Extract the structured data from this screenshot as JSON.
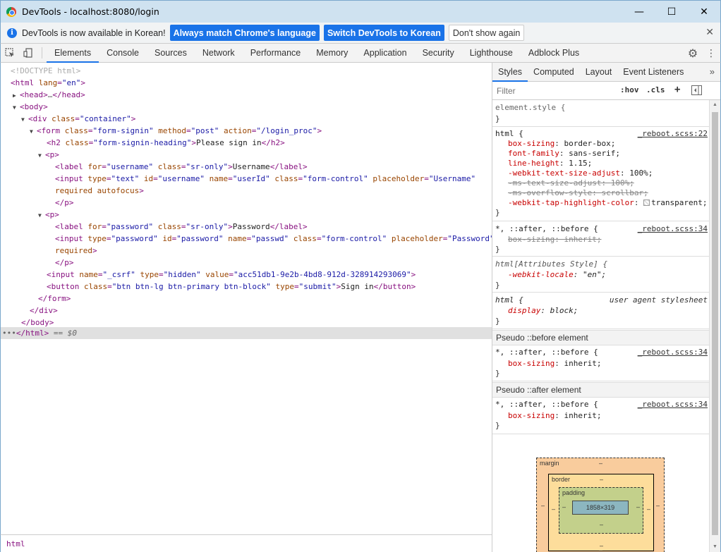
{
  "window": {
    "title": "DevTools - localhost:8080/login",
    "controls": {
      "minimize": "—",
      "maximize": "☐",
      "close": "✕"
    }
  },
  "infobar": {
    "message": "DevTools is now available in Korean!",
    "btn_match": "Always match Chrome's language",
    "btn_switch": "Switch DevTools to Korean",
    "btn_dismiss": "Don't show again",
    "close": "✕"
  },
  "toolbar": {
    "tabs": [
      "Elements",
      "Console",
      "Sources",
      "Network",
      "Performance",
      "Memory",
      "Application",
      "Security",
      "Lighthouse",
      "Adblock Plus"
    ],
    "active_tab": "Elements"
  },
  "dom": {
    "doctype": "<!DOCTYPE html>",
    "html_open": "html",
    "html_lang_attr": "lang",
    "html_lang_val": "\"en\"",
    "head": "head",
    "head_ellipsis": "…",
    "body": "body",
    "div_class_val": "\"container\"",
    "form_class_val": "\"form-signin\"",
    "form_method_val": "\"post\"",
    "form_action_val": "\"/login_proc\"",
    "h2_class_val": "\"form-signin-heading\"",
    "h2_text": "Please sign in",
    "label_user_for_val": "\"username\"",
    "label_user_class_val": "\"sr-only\"",
    "label_user_text": "Username",
    "input_user_type_val": "\"text\"",
    "input_user_id_val": "\"username\"",
    "input_user_name_val": "\"userId\"",
    "input_user_class_val": "\"form-control\"",
    "input_user_placeholder_val": "\"Username\"",
    "input_user_extra": "required autofocus",
    "label_pass_for_val": "\"password\"",
    "label_pass_class_val": "\"sr-only\"",
    "label_pass_text": "Password",
    "input_pass_type_val": "\"password\"",
    "input_pass_id_val": "\"password\"",
    "input_pass_name_val": "\"passwd\"",
    "input_pass_class_val": "\"form-control\"",
    "input_pass_placeholder_val": "\"Password\"",
    "input_pass_extra": "required",
    "csrf_name_val": "\"_csrf\"",
    "csrf_type_val": "\"hidden\"",
    "csrf_value_val": "\"acc51db1-9e2b-4bd8-912d-328914293069\"",
    "button_class_val": "\"btn btn-lg btn-primary btn-block\"",
    "button_type_val": "\"submit\"",
    "button_text": "Sign in",
    "selected_suffix": "== $0"
  },
  "breadcrumb": [
    "html"
  ],
  "styles": {
    "subtabs": [
      "Styles",
      "Computed",
      "Layout",
      "Event Listeners"
    ],
    "active_subtab": "Styles",
    "more": "»",
    "filter_placeholder": "Filter",
    "hov": ":hov",
    "cls": ".cls",
    "plus": "+",
    "rules": {
      "element_style": "element.style {",
      "html_sel": "html {",
      "reboot_src_22": "_reboot.scss:22",
      "box_sizing": "box-sizing",
      "box_sizing_val": "border-box;",
      "font_family": "font-family",
      "font_family_val": "sans-serif;",
      "line_height": "line-height",
      "line_height_val": "1.15;",
      "wtsa": "-webkit-text-size-adjust",
      "wtsa_val": "100%;",
      "mstsa": "-ms-text-size-adjust",
      "mstsa_val": "100%;",
      "msos": "-ms-overflow-style",
      "msos_val": "scrollbar;",
      "wthc": "-webkit-tap-highlight-color",
      "wthc_val": "transparent;",
      "universal_sel": "*, ::after, ::before {",
      "reboot_src_34": "_reboot.scss:34",
      "inherit": "inherit;",
      "attr_style_sel": "html[Attributes Style] {",
      "webkit_locale": "-webkit-locale",
      "webkit_locale_val": "\"en\";",
      "ua_src": "user agent stylesheet",
      "display": "display",
      "display_val": "block;",
      "close_brace": "}",
      "pseudo_before": "Pseudo ::before element",
      "pseudo_after": "Pseudo ::after element"
    },
    "box_model": {
      "margin": "margin",
      "border": "border",
      "padding": "padding",
      "dash": "–",
      "content": "1858×319"
    }
  }
}
